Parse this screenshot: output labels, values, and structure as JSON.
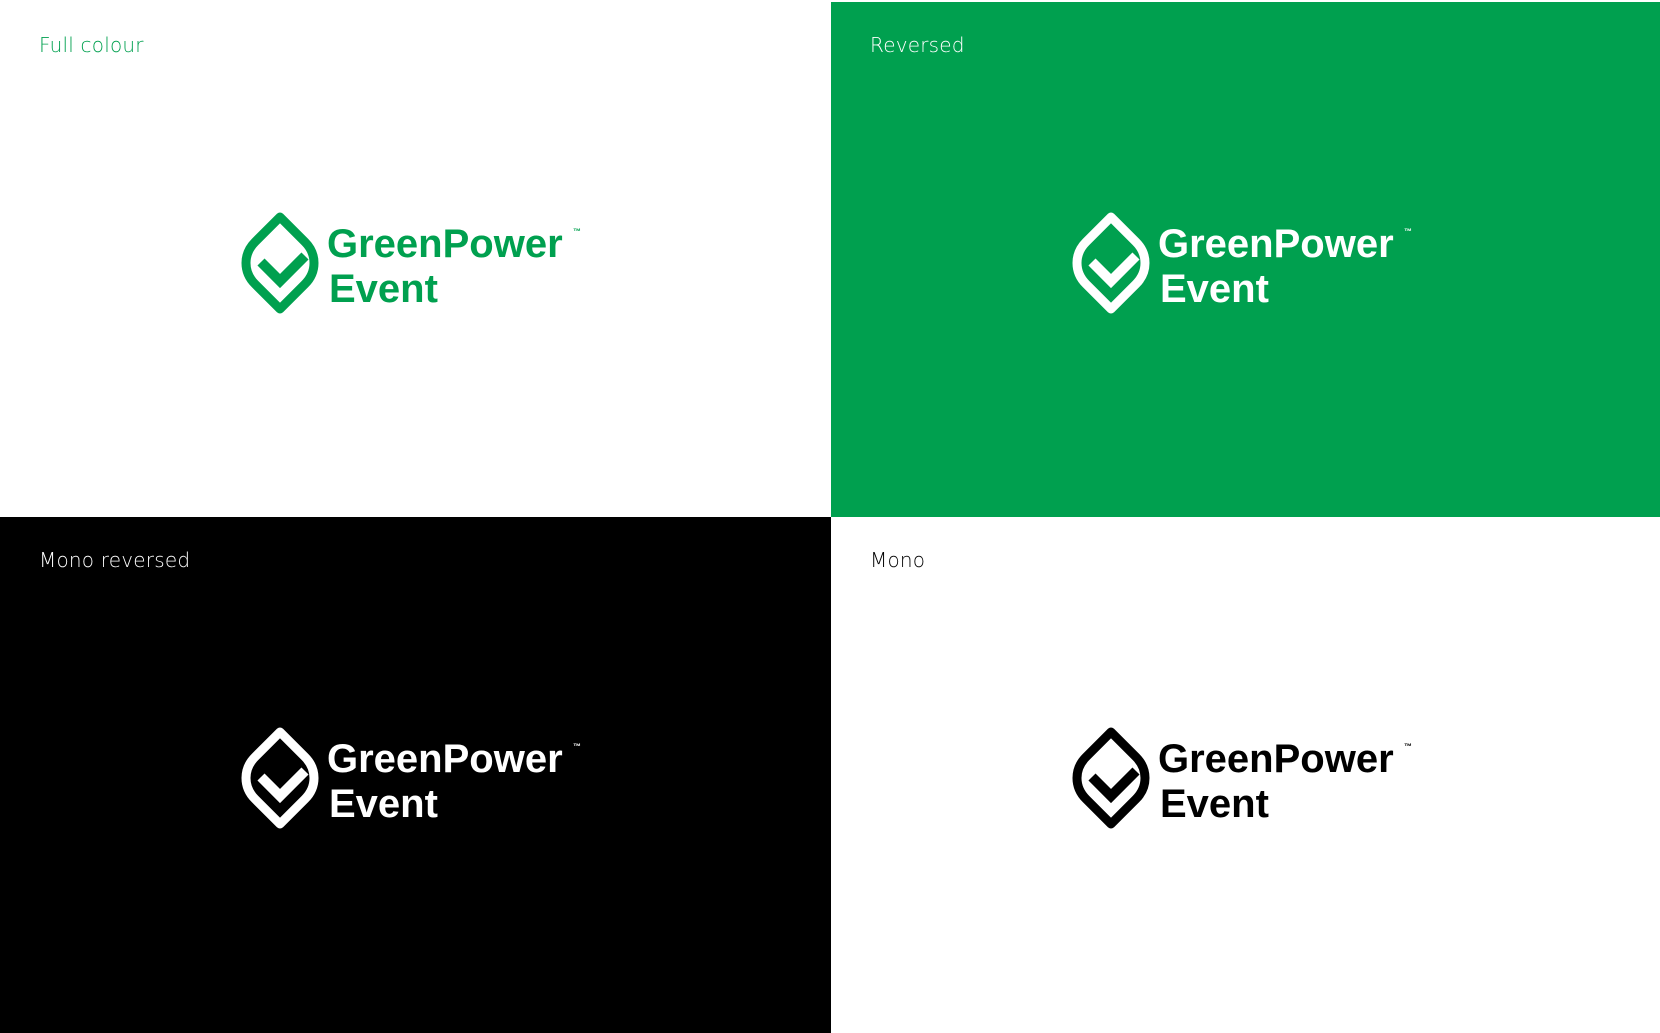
{
  "brand": {
    "name_line1": "GreenPower",
    "name_line2": "Event",
    "trademark": "™"
  },
  "colors": {
    "brand_green": "#00a04f",
    "black": "#000000",
    "white": "#ffffff"
  },
  "panels": [
    {
      "label": "Full colour",
      "background": "#ffffff",
      "label_color": "#00a04f",
      "logo_color": "#00a04f",
      "logo_icon": "leaf-check-icon"
    },
    {
      "label": "Reversed",
      "background": "#00a04f",
      "label_color": "#ffffff",
      "logo_color": "#ffffff",
      "logo_icon": "leaf-check-icon"
    },
    {
      "label": "Mono reversed",
      "background": "#000000",
      "label_color": "#ffffff",
      "logo_color": "#ffffff",
      "logo_icon": "leaf-check-icon"
    },
    {
      "label": "Mono",
      "background": "#ffffff",
      "label_color": "#000000",
      "logo_color": "#000000",
      "logo_icon": "leaf-check-icon"
    }
  ]
}
